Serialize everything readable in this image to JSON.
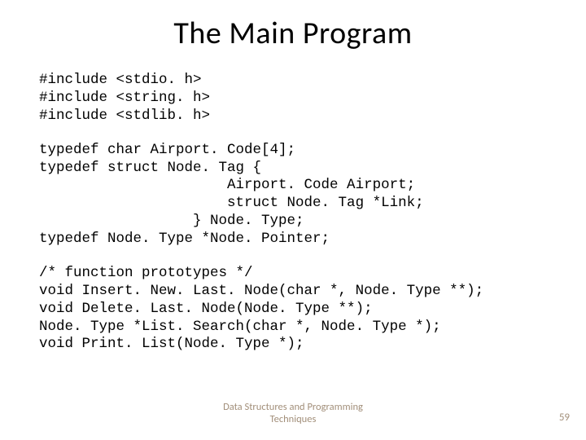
{
  "title": "The Main Program",
  "code": {
    "block1": "#include <stdio. h>\n#include <string. h>\n#include <stdlib. h>",
    "block2": "typedef char Airport. Code[4];\ntypedef struct Node. Tag {\n                      Airport. Code Airport;\n                      struct Node. Tag *Link;\n                  } Node. Type;\ntypedef Node. Type *Node. Pointer;",
    "block3": "/* function prototypes */\nvoid Insert. New. Last. Node(char *, Node. Type **);\nvoid Delete. Last. Node(Node. Type **);\nNode. Type *List. Search(char *, Node. Type *);\nvoid Print. List(Node. Type *);"
  },
  "footer": "Data Structures and Programming\nTechniques",
  "page": "59"
}
